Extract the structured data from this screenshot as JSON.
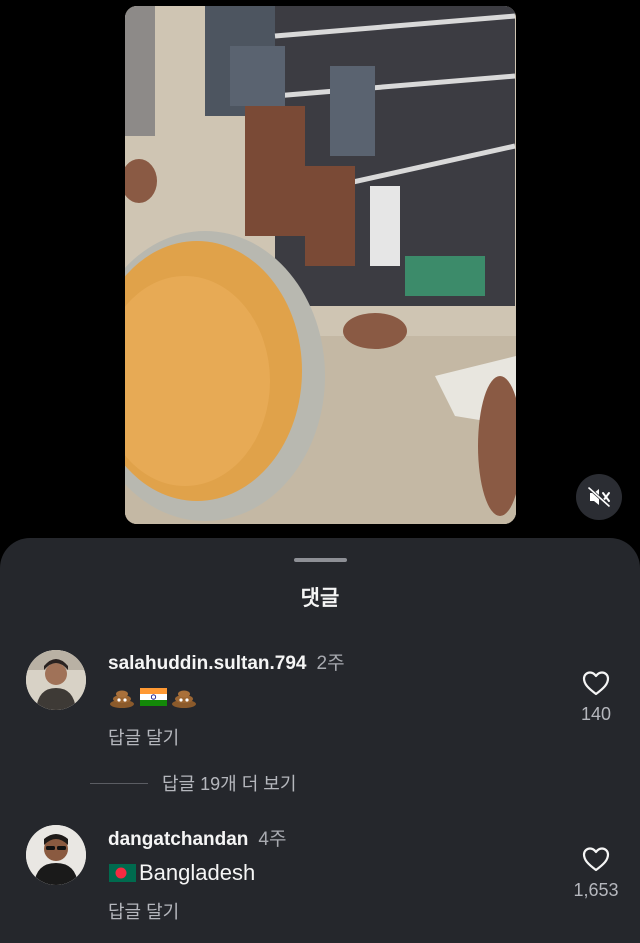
{
  "video": {
    "mute_icon": "speaker-muted-icon"
  },
  "comments_sheet": {
    "title": "댓글",
    "comments": [
      {
        "username": "salahuddin.sultan.794",
        "time": "2주",
        "body_emojis": [
          "poop-emoji",
          "india-flag-emoji",
          "poop-emoji"
        ],
        "reply_label": "답글 달기",
        "like_count": "140",
        "more_replies_label": "답글 19개 더 보기"
      },
      {
        "username": "dangatchandan",
        "time": "4주",
        "body_flag": "bangladesh-flag-emoji",
        "body_text": "Bangladesh",
        "reply_label": "답글 달기",
        "like_count": "1,653"
      }
    ]
  },
  "colors": {
    "background": "#000000",
    "sheet": "#25272c",
    "text_primary": "#f5f5f5",
    "text_secondary": "#b5b7bd"
  }
}
